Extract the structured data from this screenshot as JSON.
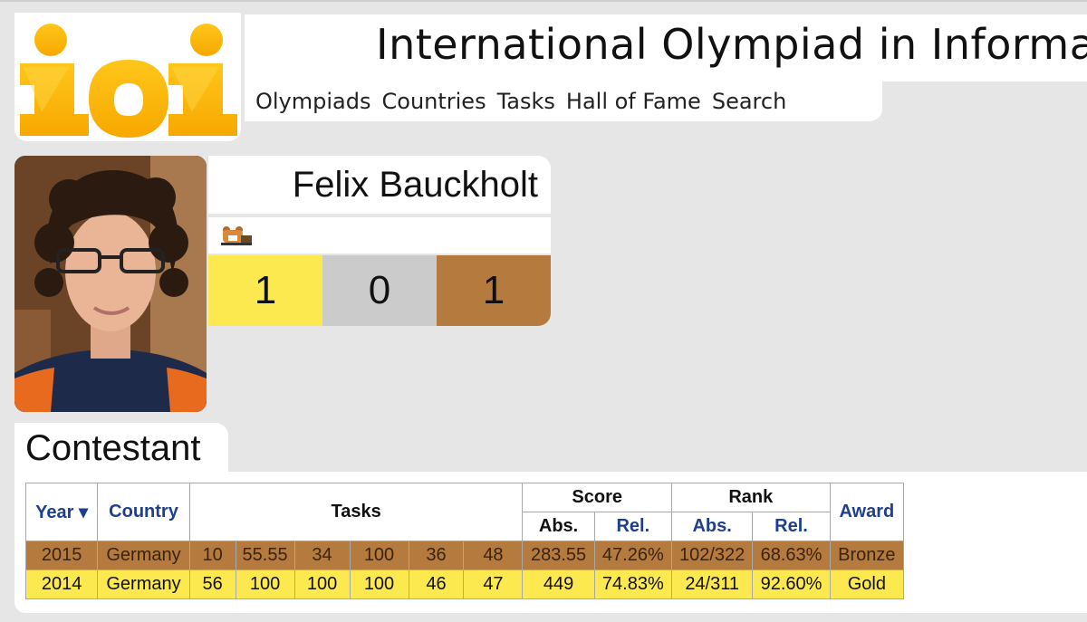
{
  "header": {
    "site_title": "International Olympiad in Informat",
    "nav": [
      "Olympiads",
      "Countries",
      "Tasks",
      "Hall of Fame",
      "Search"
    ]
  },
  "profile": {
    "name": "Felix Bauckholt",
    "medals": {
      "gold": "1",
      "silver": "0",
      "bronze": "1"
    }
  },
  "contestant": {
    "section_title": "Contestant",
    "columns": {
      "year": "Year ▾",
      "country": "Country",
      "tasks": "Tasks",
      "score": "Score",
      "rank": "Rank",
      "abs": "Abs.",
      "rel": "Rel.",
      "award": "Award"
    },
    "rows": [
      {
        "year": "2015",
        "country": "Germany",
        "tasks": [
          "10",
          "55.55",
          "34",
          "100",
          "36",
          "48"
        ],
        "score_abs": "283.55",
        "score_rel": "47.26%",
        "rank_abs": "102/322",
        "rank_rel": "68.63%",
        "award": "Bronze"
      },
      {
        "year": "2014",
        "country": "Germany",
        "tasks": [
          "56",
          "100",
          "100",
          "100",
          "46",
          "47"
        ],
        "score_abs": "449",
        "score_rel": "74.83%",
        "rank_abs": "24/311",
        "rank_rel": "92.60%",
        "award": "Gold"
      }
    ]
  },
  "colors": {
    "gold": "#fbe94f",
    "silver": "#cbcbcb",
    "bronze": "#b57a3e",
    "link": "#1e3f8f",
    "background": "#e6e6e6"
  },
  "icons": [
    "ioi-logo",
    "flag-icon",
    "avatar"
  ]
}
